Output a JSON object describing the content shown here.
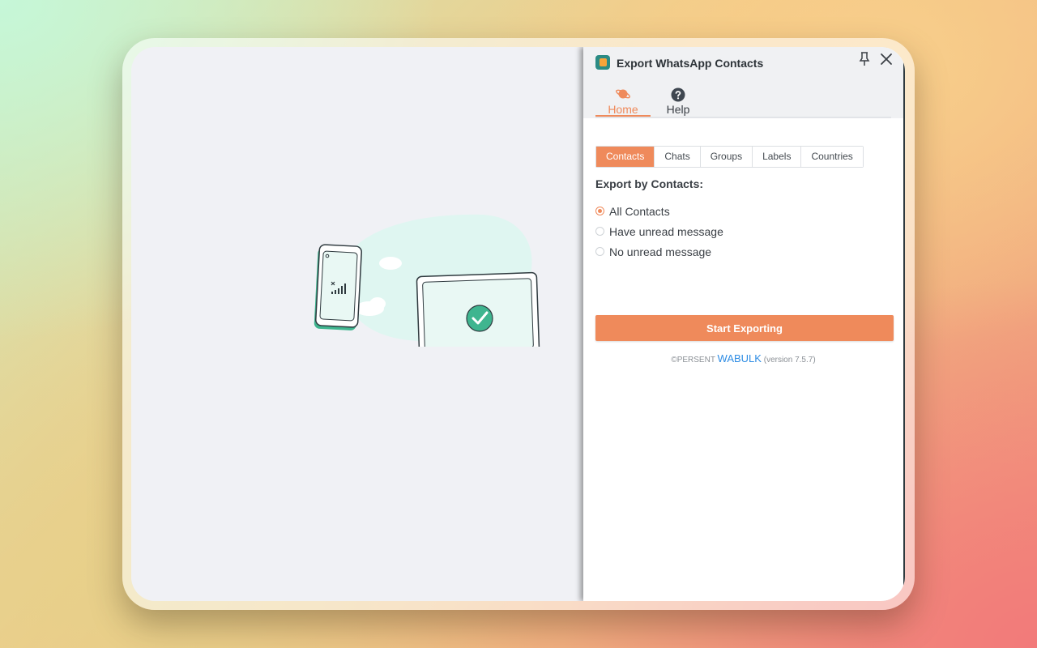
{
  "panel": {
    "title": "Export WhatsApp Contacts",
    "icons": {
      "logo": "app-logo-icon",
      "pin": "pin-icon",
      "close": "close-icon"
    }
  },
  "nav": {
    "home_label": "Home",
    "help_label": "Help",
    "home_icon": "planet-icon",
    "help_icon": "question-circle-icon",
    "active": "Home"
  },
  "tabs": [
    "Contacts",
    "Chats",
    "Groups",
    "Labels",
    "Countries"
  ],
  "active_tab": "Contacts",
  "export": {
    "title": "Export by Contacts:",
    "options": [
      "All Contacts",
      "Have unread message",
      "No unread message"
    ],
    "selected": "All Contacts",
    "button_label": "Start Exporting"
  },
  "footer": {
    "copyright": "©PERSENT",
    "brand": "WABULK",
    "version": "(version 7.5.7)"
  },
  "colors": {
    "accent": "#ef8a5b",
    "brand_link": "#2f8de4",
    "illustration_green": "#3fb58f"
  }
}
